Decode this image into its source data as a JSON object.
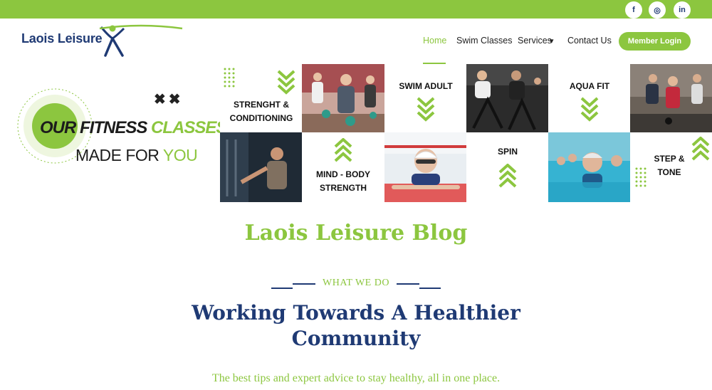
{
  "social": [
    {
      "icon": "facebook-icon",
      "glyph": "f"
    },
    {
      "icon": "instagram-icon",
      "glyph": "◎"
    },
    {
      "icon": "linkedin-icon",
      "glyph": "in"
    }
  ],
  "logo": {
    "text": "Laois Leisure"
  },
  "nav": {
    "items": [
      "Home",
      "Swim Classes",
      "Services",
      "Contact Us"
    ],
    "services_caret": "▾",
    "member_login": "Member Login"
  },
  "banner": {
    "headline_a": "OUR FITNESS",
    "headline_b": "CLASSES",
    "sub_a": "MADE FOR",
    "sub_b": "YOU",
    "marks": "✖✖",
    "tiles": {
      "strength": "STRENGHT & CONDITIONING",
      "swim_adult": "SWIM ADULT",
      "aqua_fit": "AQUA FIT",
      "mind_body": "MIND - BODY STRENGTH",
      "spin": "SPIN",
      "step_tone": "STEP & TONE"
    }
  },
  "blog": {
    "title": "Laois Leisure Blog",
    "eyebrow": "WHAT WE DO",
    "heading_line1": "Working Towards A Healthier",
    "heading_line2": "Community",
    "tagline": "The best tips and expert advice to stay healthy, all in one place."
  },
  "colors": {
    "green": "#8cc63f",
    "navy": "#1f3a74"
  }
}
